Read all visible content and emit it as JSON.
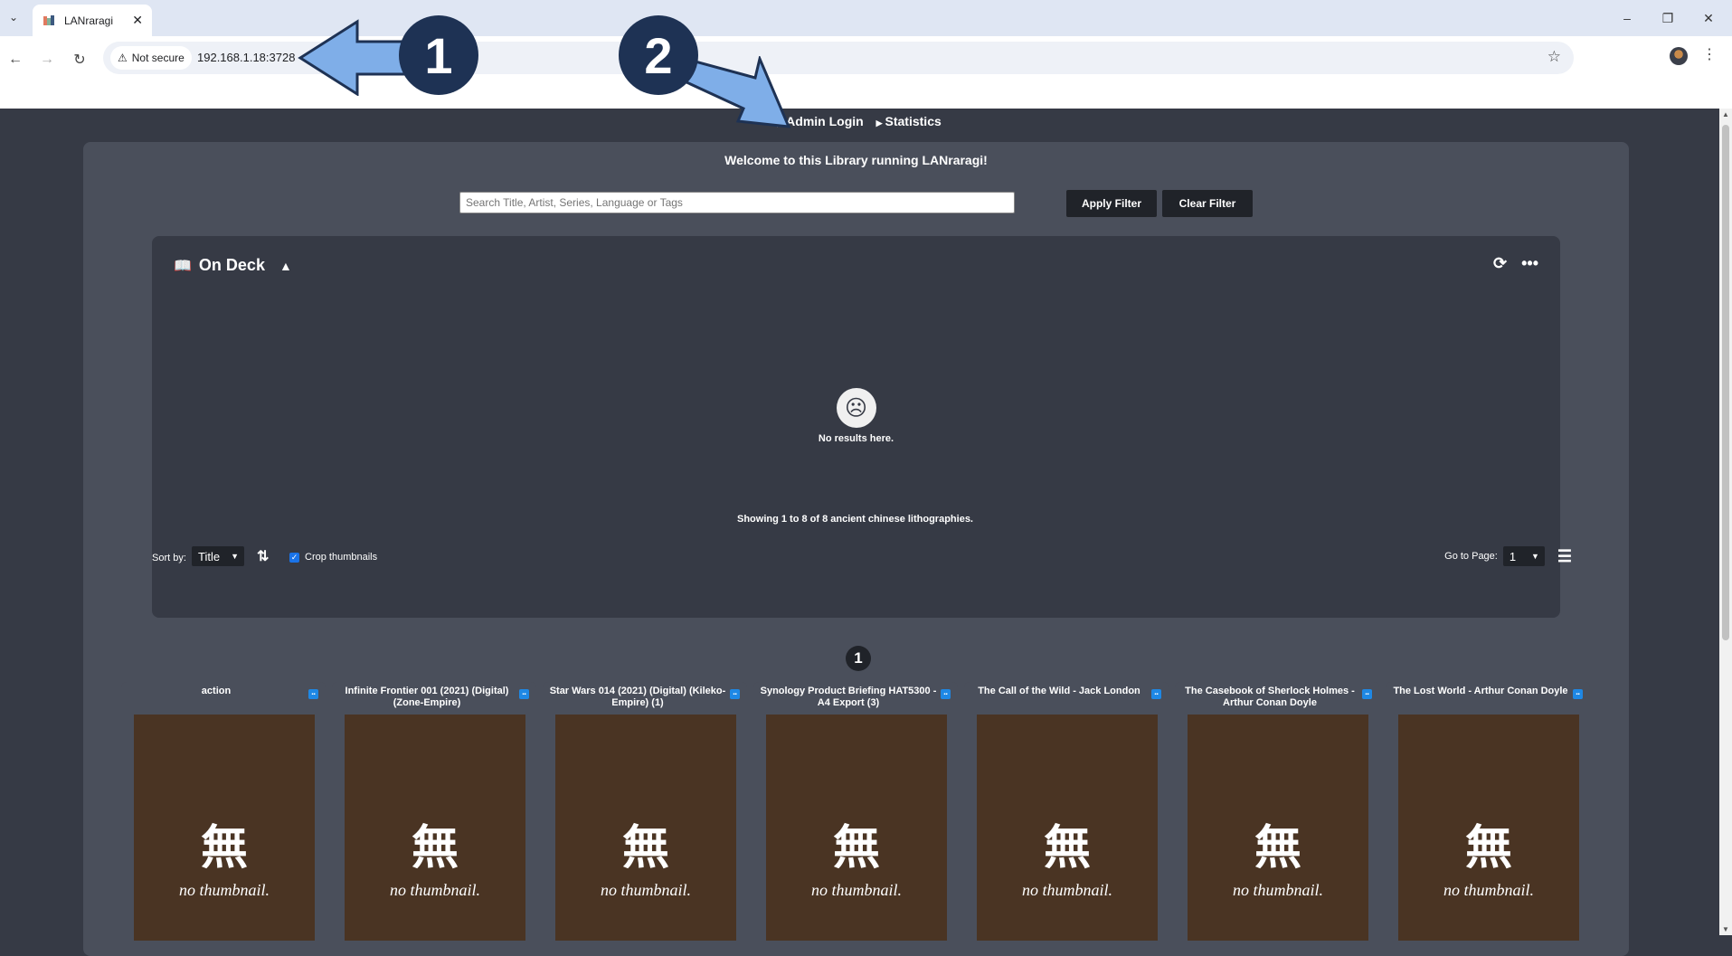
{
  "browser": {
    "tab_title": "LANraragi",
    "security_label": "Not secure",
    "url": "192.168.1.18:3728",
    "window_controls": [
      "minimize-icon",
      "restore-icon",
      "close-icon"
    ]
  },
  "annotations": {
    "marker_1": "1",
    "marker_2": "2",
    "accent_color": "#7faee8",
    "marker_color": "#1e3254"
  },
  "nav": {
    "admin_login": "Admin Login",
    "statistics": "Statistics"
  },
  "main": {
    "welcome": "Welcome to this Library running LANraragi!",
    "search_placeholder": "Search Title, Artist, Series, Language or Tags",
    "apply_filter": "Apply Filter",
    "clear_filter": "Clear Filter"
  },
  "on_deck": {
    "title": "On Deck",
    "empty_text": "No results here."
  },
  "results": {
    "showing": "Showing 1 to 8 of 8 ancient chinese lithographies.",
    "sort_label": "Sort by:",
    "sort_value": "Title",
    "crop_label": "Crop thumbnails",
    "crop_checked": true,
    "page_number": "1",
    "goto_label": "Go to Page:",
    "goto_value": "1"
  },
  "archives": [
    {
      "title": "action",
      "thumb_glyph": "無",
      "thumb_text": "no thumbnail."
    },
    {
      "title": "Infinite Frontier 001 (2021) (Digital) (Zone-Empire)",
      "thumb_glyph": "無",
      "thumb_text": "no thumbnail."
    },
    {
      "title": "Star Wars 014 (2021) (Digital) (Kileko-Empire) (1)",
      "thumb_glyph": "無",
      "thumb_text": "no thumbnail."
    },
    {
      "title": "Synology Product Briefing HAT5300 - A4 Export (3)",
      "thumb_glyph": "無",
      "thumb_text": "no thumbnail."
    },
    {
      "title": "The Call of the Wild - Jack London",
      "thumb_glyph": "無",
      "thumb_text": "no thumbnail."
    },
    {
      "title": "The Casebook of Sherlock Holmes - Arthur Conan Doyle",
      "thumb_glyph": "無",
      "thumb_text": "no thumbnail."
    },
    {
      "title": "The Lost World - Arthur Conan Doyle",
      "thumb_glyph": "無",
      "thumb_text": "no thumbnail."
    }
  ]
}
